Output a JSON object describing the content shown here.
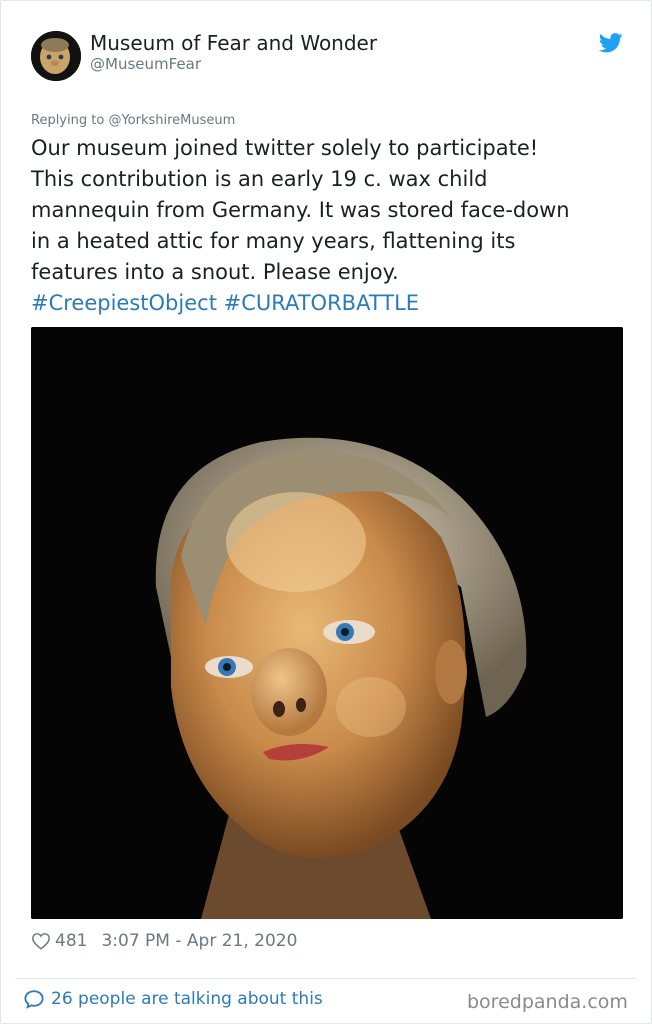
{
  "author": {
    "display_name": "Museum of Fear and Wonder",
    "handle": "@MuseumFear"
  },
  "reply": {
    "prefix": "Replying to ",
    "to_handle": "@YorkshireMuseum"
  },
  "tweet": {
    "lines": [
      "Our museum joined twitter solely to participate!",
      "This contribution is an early 19 c. wax child",
      "mannequin from Germany. It was stored face-down",
      "in a heated attic for many years, flattening its",
      "features into a snout. Please enjoy."
    ],
    "hashtags": [
      "#CreepiestObject",
      "#CURATORBATTLE"
    ]
  },
  "meta": {
    "likes": "481",
    "timestamp": "3:07 PM - Apr 21, 2020"
  },
  "conversation": {
    "label": "26 people are talking about this"
  },
  "watermark": "boredpanda.com",
  "colors": {
    "link_blue": "#2b7bb9",
    "twitter_blue": "#1da1f2",
    "muted": "#697882",
    "media_background": "#050505"
  },
  "icons": {
    "brand": "twitter-bird-icon",
    "like": "heart-icon",
    "conversation": "speech-bubble-icon"
  }
}
